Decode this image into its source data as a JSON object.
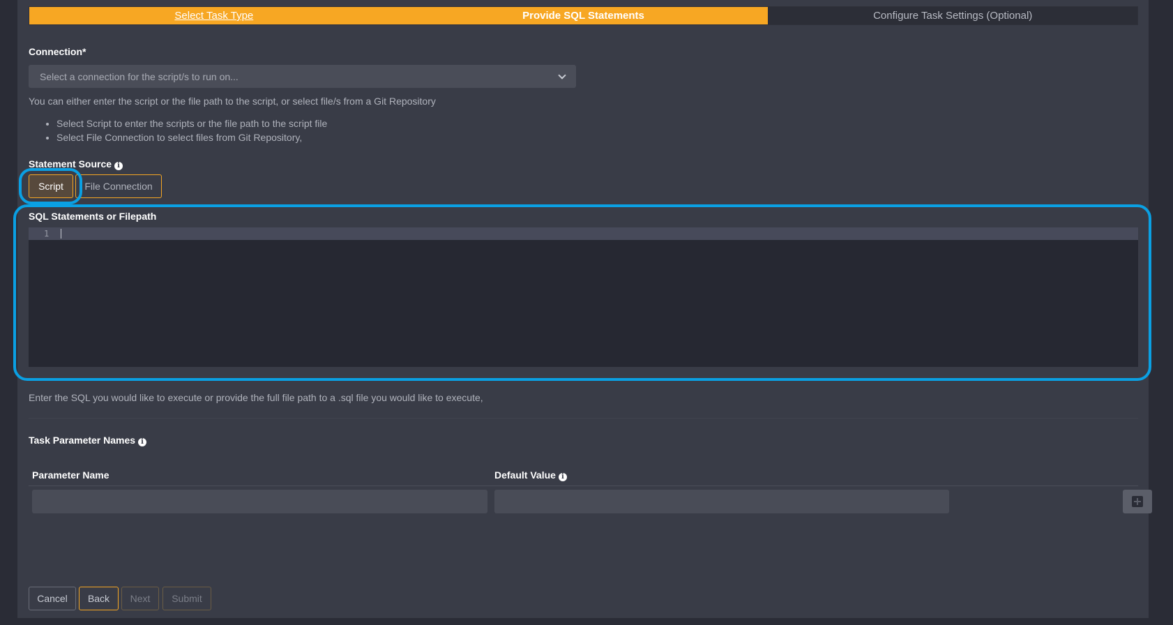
{
  "wizard": {
    "steps": [
      {
        "label": "Select Task Type",
        "state": "done"
      },
      {
        "label": "Provide SQL Statements",
        "state": "active"
      },
      {
        "label": "Configure Task Settings (Optional)",
        "state": "todo"
      }
    ]
  },
  "connection": {
    "label": "Connection*",
    "placeholder": "Select a connection for the script/s to run on..."
  },
  "source_help": {
    "intro": "You can either enter the script or the file path to the script, or select file/s from a Git Repository",
    "bullets": [
      "Select Script to enter the scripts or the file path to the script file",
      "Select File Connection to select files from Git Repository,"
    ]
  },
  "statement_source": {
    "label": "Statement Source",
    "options": [
      "Script",
      "File Connection"
    ],
    "selected": "Script"
  },
  "editor": {
    "label": "SQL Statements or Filepath",
    "line_number": "1",
    "help": "Enter the SQL you would like to execute or provide the full file path to a .sql file you would like to execute,"
  },
  "parameters": {
    "label": "Task Parameter Names",
    "columns": [
      "Parameter Name",
      "Default Value"
    ]
  },
  "footer": {
    "buttons": [
      "Cancel",
      "Back",
      "Next",
      "Submit"
    ]
  },
  "colors": {
    "accent": "#f7a723",
    "highlight": "#0aa0e3",
    "panel": "#393c47",
    "background": "#2a2c36"
  }
}
